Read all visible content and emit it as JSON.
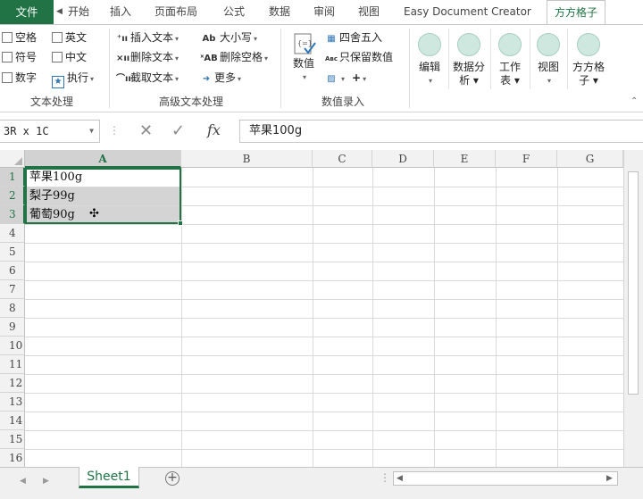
{
  "tabs": {
    "file": "文件",
    "home": "开始",
    "insert": "插入",
    "page_layout": "页面布局",
    "formulas": "公式",
    "data": "数据",
    "review": "审阅",
    "view": "视图",
    "easy_doc": "Easy Document Creator",
    "fangfang": "方方格子"
  },
  "ribbon": {
    "text_group": {
      "label": "文本处理",
      "row1": [
        "空格",
        "英文"
      ],
      "row2": [
        "符号",
        "中文"
      ],
      "row3_left": "数字",
      "row3_right": "执行"
    },
    "advanced_group": {
      "label": "高级文本处理",
      "insert_text": "插入文本",
      "delete_text": "删除文本",
      "extract_text": "截取文本",
      "case": "大小写",
      "delete_space": "删除空格",
      "more": "更多"
    },
    "number_group": {
      "label": "数值录入",
      "value": "数值",
      "round": "四舍五入",
      "keep_value": "只保留数值"
    },
    "big_buttons": [
      {
        "line1": "编辑",
        "line2": "▾"
      },
      {
        "line1": "数据分",
        "line2": "析 ▾"
      },
      {
        "line1": "工作",
        "line2": "表 ▾"
      },
      {
        "line1": "视图",
        "line2": "▾"
      },
      {
        "line1": "方方格",
        "line2": "子 ▾"
      }
    ]
  },
  "formula_bar": {
    "name_box": "3R x 1C",
    "fx": "fx",
    "content": "苹果100g"
  },
  "columns": [
    "A",
    "B",
    "C",
    "D",
    "E",
    "F",
    "G"
  ],
  "rows": [
    "1",
    "2",
    "3",
    "4",
    "5",
    "6",
    "7",
    "8",
    "9",
    "10",
    "11",
    "12",
    "13",
    "14",
    "15",
    "16"
  ],
  "cells": {
    "a1": "苹果100g",
    "a2": "梨子99g",
    "a3": "葡萄90g"
  },
  "sheet_tab": "Sheet1",
  "colors": {
    "excel_green": "#217346",
    "selection_fill": "#d4d4d4"
  }
}
